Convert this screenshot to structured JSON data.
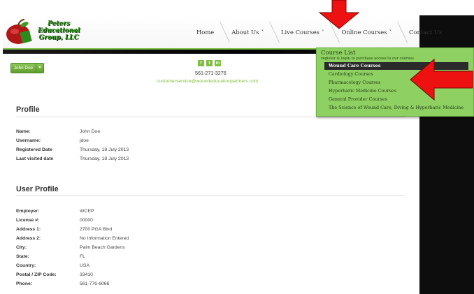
{
  "brand": {
    "logo_line1": "Peters",
    "logo_line2": "Educational",
    "logo_line3": "Group, LLC"
  },
  "nav": {
    "items": [
      {
        "label": "Home",
        "has_dropdown": false
      },
      {
        "label": "About Us",
        "has_dropdown": true
      },
      {
        "label": "Live Courses",
        "has_dropdown": true
      },
      {
        "label": "Online Courses",
        "has_dropdown": true
      },
      {
        "label": "Contact Us",
        "has_dropdown": false
      }
    ],
    "chevron": "˅"
  },
  "user_menu": {
    "label": "John Doe",
    "caret": "▾"
  },
  "contact": {
    "social_icons": [
      "facebook-icon",
      "twitter-icon",
      "linkedin-icon"
    ],
    "social_glyphs": [
      "f",
      "t",
      "in"
    ],
    "phone": "561-271-3276",
    "email": "customerservice@woundeducationpartners.com"
  },
  "profile": {
    "title": "Profile",
    "rows": [
      {
        "label": "Name:",
        "value": "John Doe"
      },
      {
        "label": "Username:",
        "value": "jdoe"
      },
      {
        "label": "Registered Date",
        "value": "Thursday, 18 July 2013"
      },
      {
        "label": "Last visited date",
        "value": "Thursday, 18 July 2013"
      }
    ]
  },
  "user_profile": {
    "title": "User Profile",
    "rows": [
      {
        "label": "Employer:",
        "value": "WCEP"
      },
      {
        "label": "License #:",
        "value": "00000"
      },
      {
        "label": "Address 1:",
        "value": "2700 PGA Blvd"
      },
      {
        "label": "Address 2:",
        "value": "No Information Entered"
      },
      {
        "label": "City:",
        "value": "Palm Beach Gardens"
      },
      {
        "label": "State:",
        "value": "FL"
      },
      {
        "label": "Country:",
        "value": "USA"
      },
      {
        "label": "Postal / ZIP Code:",
        "value": "33410"
      },
      {
        "label": "Phone:",
        "value": "561-776-6066"
      }
    ]
  },
  "dropdown": {
    "title": "Course List",
    "subtitle": "register & login to purchase access to our courses",
    "items": [
      {
        "label": "Wound Care Courses",
        "active": true
      },
      {
        "label": "Cardiology Courses",
        "active": false
      },
      {
        "label": "Pharmacology Courses",
        "active": false
      },
      {
        "label": "Hyperbaric Medicine Courses",
        "active": false
      },
      {
        "label": "General Provider Courses",
        "active": false
      },
      {
        "label": "The Science of Wound Care, Diving & Hyperbaric Medicine",
        "active": false
      }
    ]
  },
  "colors": {
    "accent_green": "#7fbd3e",
    "dropdown_green": "#8fd063",
    "annotation_red": "#ee1111"
  }
}
